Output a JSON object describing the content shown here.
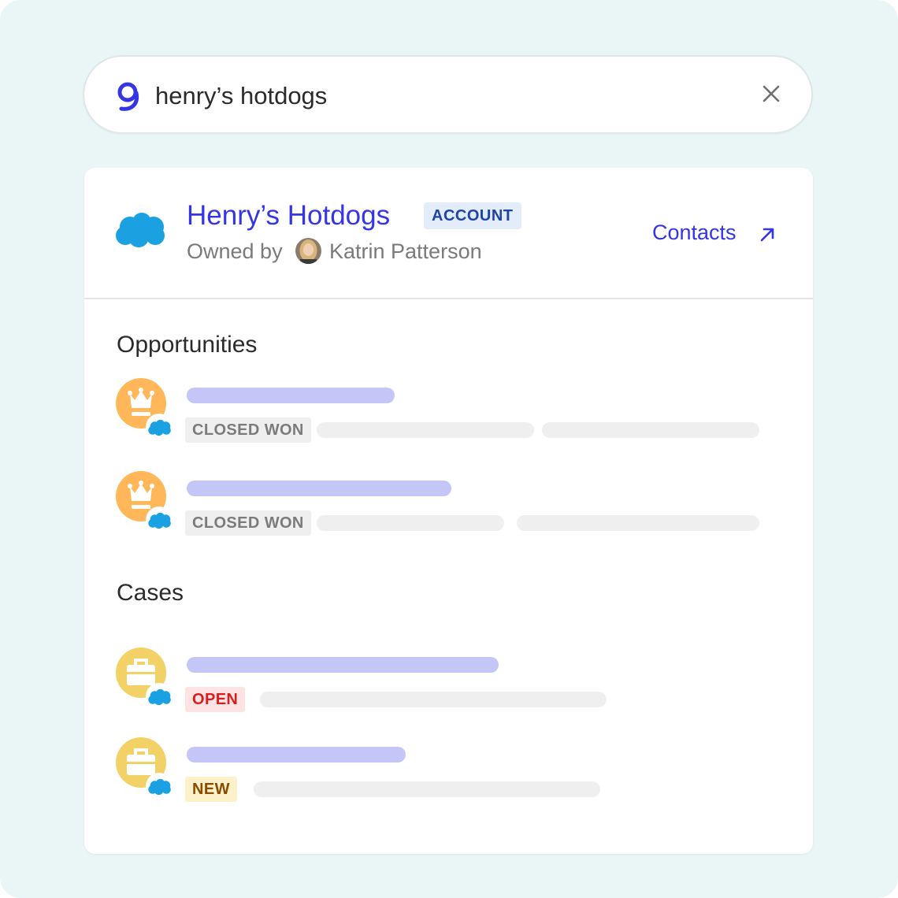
{
  "search": {
    "query": "henry’s hotdogs",
    "logo_icon": "glean-g-icon",
    "clear_icon": "close-icon"
  },
  "account": {
    "title": "Henry’s Hotdogs",
    "badge": "ACCOUNT",
    "owned_by_label": "Owned by",
    "owner_name": "Katrin Patterson",
    "contacts_link": "Contacts",
    "source_icon": "salesforce-cloud-icon"
  },
  "opportunities": {
    "heading": "Opportunities",
    "items": [
      {
        "status": "CLOSED WON",
        "icon": "crown-icon"
      },
      {
        "status": "CLOSED WON",
        "icon": "crown-icon"
      }
    ]
  },
  "cases": {
    "heading": "Cases",
    "items": [
      {
        "status": "OPEN",
        "icon": "briefcase-icon"
      },
      {
        "status": "NEW",
        "icon": "briefcase-icon"
      }
    ]
  },
  "colors": {
    "background": "#eaf6f6",
    "accent": "#3535e6",
    "salesforce_blue": "#1ba0e2",
    "opportunity_icon": "#ffb75a",
    "case_icon": "#f2d167",
    "placeholder_title": "#c4c6f8",
    "placeholder_line": "#efefef"
  }
}
